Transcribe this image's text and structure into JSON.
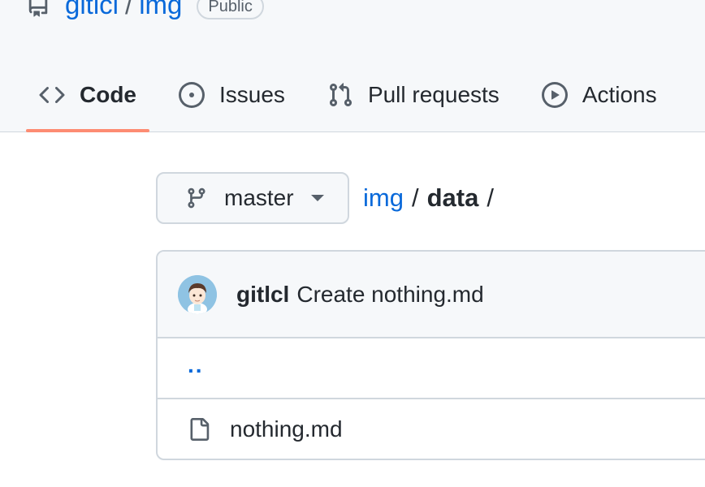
{
  "repo": {
    "owner": "gitlcl",
    "separator": "/",
    "name": "img",
    "visibility": "Public"
  },
  "tabs": [
    {
      "label": "Code",
      "icon": "code-icon",
      "selected": true
    },
    {
      "label": "Issues",
      "icon": "issue-opened-icon",
      "selected": false
    },
    {
      "label": "Pull requests",
      "icon": "git-pull-request-icon",
      "selected": false
    },
    {
      "label": "Actions",
      "icon": "play-icon",
      "selected": false
    }
  ],
  "branch": {
    "name": "master",
    "icon": "git-branch-icon"
  },
  "breadcrumb": {
    "root": "img",
    "separator": "/",
    "current": "data",
    "trailing": "/"
  },
  "latest_commit": {
    "author": "gitlcl",
    "message": "Create nothing.md"
  },
  "files": {
    "parent_link": "..",
    "items": [
      {
        "name": "nothing.md",
        "icon": "file-icon"
      }
    ]
  },
  "colors": {
    "link": "#0969da",
    "tab_underline": "#fd8c73",
    "border": "#d0d7de",
    "header_bg": "#f6f8fa"
  }
}
